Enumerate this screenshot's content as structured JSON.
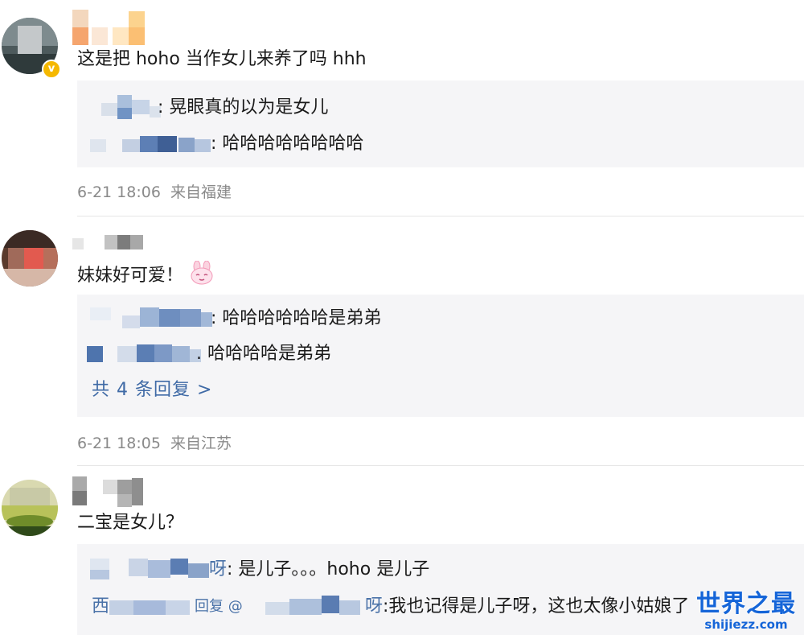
{
  "comments": [
    {
      "text": "这是把 hoho 当作女儿来养了吗 hhh",
      "replies": [
        {
          "text": ": 晃眼真的以为是女儿"
        },
        {
          "text": ": 哈哈哈哈哈哈哈哈"
        }
      ],
      "time": "6-21 18:06",
      "location": "来自福建"
    },
    {
      "text": "妹妹好可爱！",
      "emoji": "bunny-emoji-icon",
      "replies": [
        {
          "text": ": 哈哈哈哈哈哈是弟弟"
        },
        {
          "text": ". 哈哈哈哈是弟弟"
        }
      ],
      "more_replies": "共 4 条回复 >",
      "time": "6-21 18:05",
      "location": "来自江苏"
    },
    {
      "text": "二宝是女儿？",
      "replies": [
        {
          "name_tail": "呀",
          "text": ": 是儿子。。。hoho 是儿子"
        },
        {
          "name_head": "西",
          "mid": "回复 @",
          "name_tail": "呀",
          "text": ":我也记得是儿子呀，这也太像小姑娘了"
        }
      ]
    }
  ],
  "watermark": {
    "title": "世界之最",
    "url": "shijiezz.com"
  },
  "colors": {
    "link": "#3f6aa6",
    "meta": "#8a8a8a",
    "reply_bg": "#f5f5f7",
    "verified_badge": "#f5b800"
  }
}
